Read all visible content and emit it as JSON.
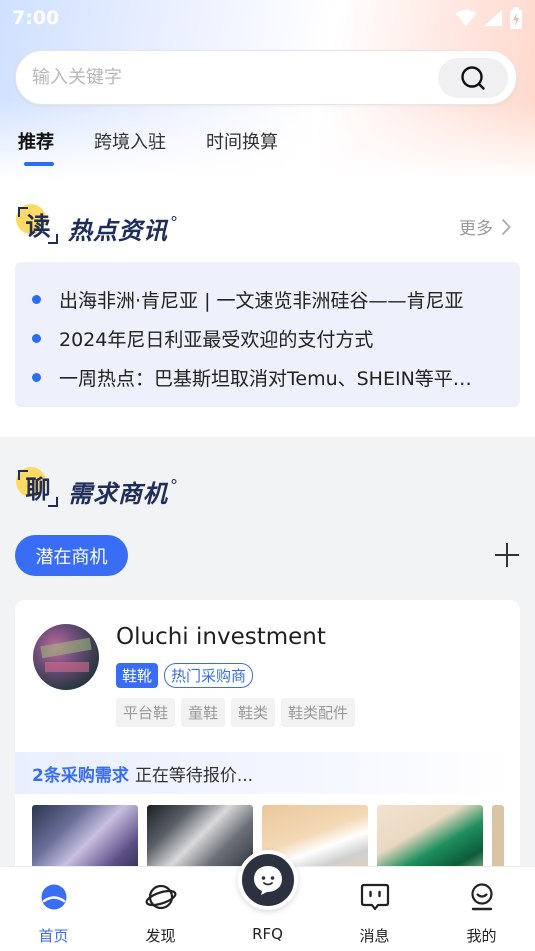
{
  "status_bar": {
    "time": "7:00"
  },
  "search": {
    "placeholder": "输入关键字"
  },
  "tabs": [
    {
      "label": "推荐",
      "active": true
    },
    {
      "label": "跨境入驻",
      "active": false
    },
    {
      "label": "时间换算",
      "active": false
    }
  ],
  "read_section": {
    "badge_char": "读",
    "title": "热点资讯",
    "more_label": "更多",
    "news": [
      "出海非洲·肯尼亚 | 一文速览非洲硅谷——肯尼亚",
      "2024年尼日利亚最受欢迎的支付方式",
      "一周热点：巴基斯坦取消对Temu、SHEIN等平…"
    ]
  },
  "chat_section": {
    "badge_char": "聊",
    "title": "需求商机",
    "pill_label": "潜在商机",
    "card": {
      "company": "Oluchi investment",
      "category_tag": "鞋靴",
      "type_tag": "热门采购商",
      "sub_tags": [
        "平台鞋",
        "童鞋",
        "鞋类",
        "鞋类配件"
      ],
      "demand_count": "2条采购需求",
      "demand_status": "正在等待报价..."
    }
  },
  "bottom_nav": {
    "items": [
      {
        "label": "首页",
        "icon": "home-planet-icon",
        "active": true
      },
      {
        "label": "发现",
        "icon": "discover-planet-icon",
        "active": false
      },
      {
        "label": "RFQ",
        "icon": "rfq-chat-icon",
        "active": false
      },
      {
        "label": "消息",
        "icon": "message-icon",
        "active": false
      },
      {
        "label": "我的",
        "icon": "profile-icon",
        "active": false
      }
    ]
  },
  "colors": {
    "accent": "#3a6df5",
    "title_navy": "#1f2d5a",
    "badge_yellow": "#ffd54a"
  }
}
